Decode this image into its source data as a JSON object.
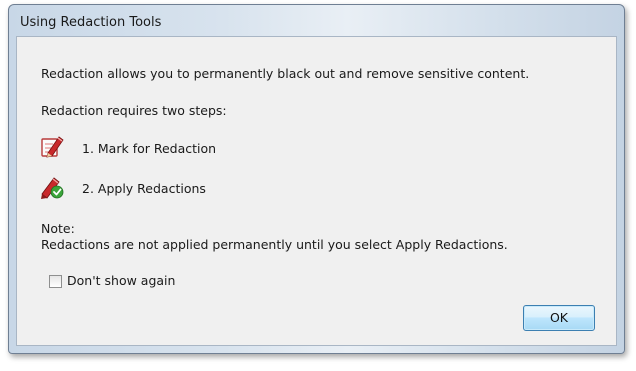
{
  "window": {
    "title": "Using Redaction Tools"
  },
  "content": {
    "intro": "Redaction allows you to permanently black out and remove sensitive content.",
    "steps_heading": "Redaction requires two steps:",
    "steps": [
      {
        "label": "1. Mark for Redaction",
        "icon": "mark-redaction-pen-icon"
      },
      {
        "label": "2. Apply Redactions",
        "icon": "apply-redactions-icon"
      }
    ],
    "note_heading": "Note:",
    "note_text": "Redactions are not applied permanently until you select Apply Redactions."
  },
  "options": {
    "dont_show_again_label": "Don't show again",
    "dont_show_again_checked": false
  },
  "buttons": {
    "ok_label": "OK"
  },
  "colors": {
    "button_border": "#3c7fb1",
    "icon_red": "#c8282b",
    "icon_green": "#3aa43a"
  }
}
